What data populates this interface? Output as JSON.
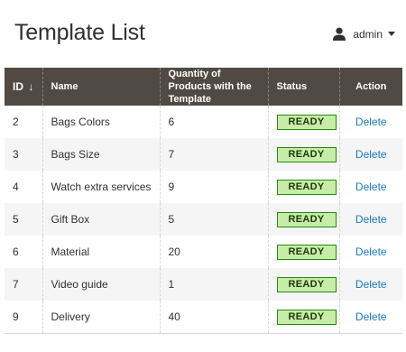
{
  "page": {
    "title": "Template List"
  },
  "user": {
    "name": "admin",
    "icon": "user-icon"
  },
  "grid": {
    "columns": {
      "id": "ID",
      "name": "Name",
      "quantity": "Quantity of Products with the Template",
      "status": "Status",
      "action": "Action"
    },
    "sort_indicator": "↓",
    "rows": [
      {
        "id": "2",
        "name": "Bags Colors",
        "quantity": "6",
        "status": "READY",
        "action": "Delete"
      },
      {
        "id": "3",
        "name": "Bags Size",
        "quantity": "7",
        "status": "READY",
        "action": "Delete"
      },
      {
        "id": "4",
        "name": "Watch extra services",
        "quantity": "9",
        "status": "READY",
        "action": "Delete"
      },
      {
        "id": "5",
        "name": "Gift Box",
        "quantity": "5",
        "status": "READY",
        "action": "Delete"
      },
      {
        "id": "6",
        "name": "Material",
        "quantity": "20",
        "status": "READY",
        "action": "Delete"
      },
      {
        "id": "7",
        "name": "Video guide",
        "quantity": "1",
        "status": "READY",
        "action": "Delete"
      },
      {
        "id": "9",
        "name": "Delivery",
        "quantity": "40",
        "status": "READY",
        "action": "Delete"
      }
    ]
  },
  "colors": {
    "header_bg": "#514943",
    "link": "#1979c3",
    "status_bg": "#c7ecaa",
    "status_border": "#1e8f09",
    "row_alt": "#f5f5f5"
  }
}
